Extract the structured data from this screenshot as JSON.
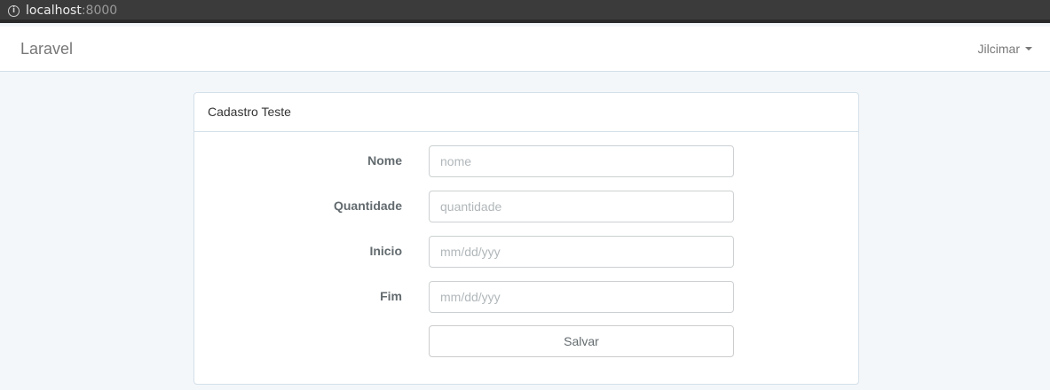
{
  "browser": {
    "url_host": "localhost",
    "url_port": ":8000"
  },
  "navbar": {
    "brand": "Laravel",
    "user_name": "Jilcimar"
  },
  "panel": {
    "title": "Cadastro Teste",
    "fields": [
      {
        "label": "Nome",
        "placeholder": "nome",
        "value": ""
      },
      {
        "label": "Quantidade",
        "placeholder": "quantidade",
        "value": ""
      },
      {
        "label": "Inicio",
        "placeholder": "mm/dd/yyy",
        "value": ""
      },
      {
        "label": "Fim",
        "placeholder": "mm/dd/yyy",
        "value": ""
      }
    ],
    "submit_label": "Salvar"
  }
}
